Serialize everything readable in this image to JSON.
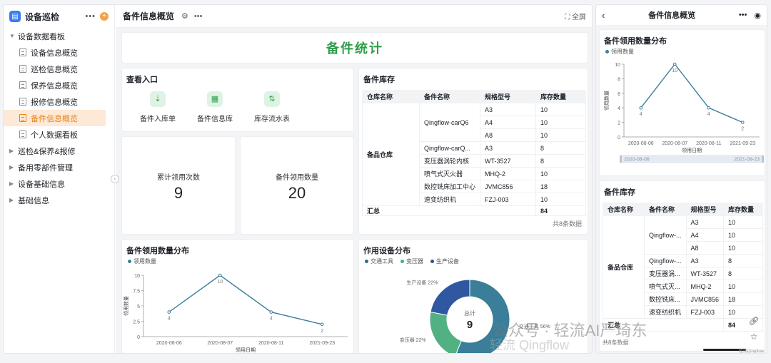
{
  "sidebar": {
    "title": "设备巡检",
    "groups": [
      {
        "label": "设备数据看板",
        "expanded": true
      },
      {
        "label": "巡检&保养&报修"
      },
      {
        "label": "备用零部件管理"
      },
      {
        "label": "设备基础信息"
      },
      {
        "label": "基础信息"
      }
    ],
    "items": [
      "设备信息概览",
      "巡检信息概览",
      "保养信息概览",
      "报修信息概览",
      "备件信息概览",
      "个人数据看板"
    ],
    "active_item": "备件信息概览"
  },
  "header": {
    "title": "备件信息概览",
    "fullscreen_label": "全屏"
  },
  "banner": {
    "title": "备件统计"
  },
  "entry": {
    "title": "查看入口",
    "items": [
      "备件入库单",
      "备件信息库",
      "库存流水表"
    ]
  },
  "stats": [
    {
      "label": "累计领用次数",
      "value": "9"
    },
    {
      "label": "备件领用数量",
      "value": "20"
    }
  ],
  "inventory": {
    "title": "备件库存",
    "columns": [
      "仓库名称",
      "备件名称",
      "规格型号",
      "库存数量"
    ],
    "warehouse": "备品仓库",
    "rows": [
      {
        "name": "Qingflow-carQ6",
        "spec": "A3",
        "qty": "10"
      },
      {
        "name": "",
        "spec": "A4",
        "qty": "10"
      },
      {
        "name": "",
        "spec": "A8",
        "qty": "10"
      },
      {
        "name": "Qingflow-carQ...",
        "spec": "A3",
        "qty": "8"
      },
      {
        "name": "变压器涡轮内核",
        "spec": "WT-3527",
        "qty": "8"
      },
      {
        "name": "喷气式灭火器",
        "spec": "MHQ-2",
        "qty": "10"
      },
      {
        "name": "数控铣床加工中心",
        "spec": "JVMC856",
        "qty": "18"
      },
      {
        "name": "速变纺织机",
        "spec": "FZJ-003",
        "qty": "10"
      }
    ],
    "total_label": "汇总",
    "total_value": "84",
    "footer": "共8条数据"
  },
  "inventory_mobile": {
    "rows": [
      {
        "name": "Qingflow-...",
        "spec": "A3",
        "qty": "10"
      },
      {
        "name": "",
        "spec": "A4",
        "qty": "10"
      },
      {
        "name": "",
        "spec": "A8",
        "qty": "10"
      },
      {
        "name": "Qingflow-...",
        "spec": "A3",
        "qty": "8"
      },
      {
        "name": "变压器涡...",
        "spec": "WT-3527",
        "qty": "8"
      },
      {
        "name": "喷气式灭...",
        "spec": "MHQ-2",
        "qty": "10"
      },
      {
        "name": "数控铣床...",
        "spec": "JVMC856",
        "qty": "18"
      },
      {
        "name": "速变纺织机",
        "spec": "FZJ-003",
        "qty": "10"
      }
    ],
    "footer": "共8条数据"
  },
  "usage_chart": {
    "title": "备件领用数量分布"
  },
  "device_chart": {
    "title": "作用设备分布"
  },
  "mobile": {
    "title": "备件信息概览"
  },
  "watermark": {
    "line1": "公众号 · 轻流AI严琦东",
    "line2": "轻流 Qingflow",
    "corner": "轻流Qingflow"
  },
  "chart_data": [
    {
      "type": "line",
      "title": "备件领用数量分布",
      "series": [
        {
          "name": "领用数量",
          "values": [
            4,
            10,
            4,
            2
          ]
        }
      ],
      "categories": [
        "2020-08-06",
        "2020-08-07",
        "2020-08-11",
        "2021-09-23"
      ],
      "xlabel": "领用日期",
      "ylabel": "领用数量",
      "ylim": [
        0,
        10
      ],
      "yticks": [
        0,
        2.5,
        5,
        7.5,
        10
      ],
      "mobile_yticks": [
        0,
        2,
        4,
        6,
        8,
        10
      ],
      "color": "#3d7e9c",
      "grid": false,
      "legend": "top-left",
      "slider_labels": [
        "2020-08-06",
        "2021-09-23"
      ]
    },
    {
      "type": "pie",
      "title": "作用设备分布",
      "legend_items": [
        {
          "name": "交通工具",
          "color": "#2e6b8a"
        },
        {
          "name": "变压器",
          "color": "#4caf7d"
        },
        {
          "name": "生产设备",
          "color": "#2d4f8f"
        }
      ],
      "slices": [
        {
          "name": "交通工具",
          "value": 56,
          "color": "#3a7e99"
        },
        {
          "name": "变压器",
          "value": 22,
          "color": "#52b183"
        },
        {
          "name": "生产设备",
          "value": 22,
          "color": "#2f58a0"
        }
      ],
      "slice_labels": [
        "交通工具 56%",
        "变压器 22%",
        "生产设备 22%"
      ],
      "center_label": "总计",
      "center_value": "9"
    }
  ]
}
